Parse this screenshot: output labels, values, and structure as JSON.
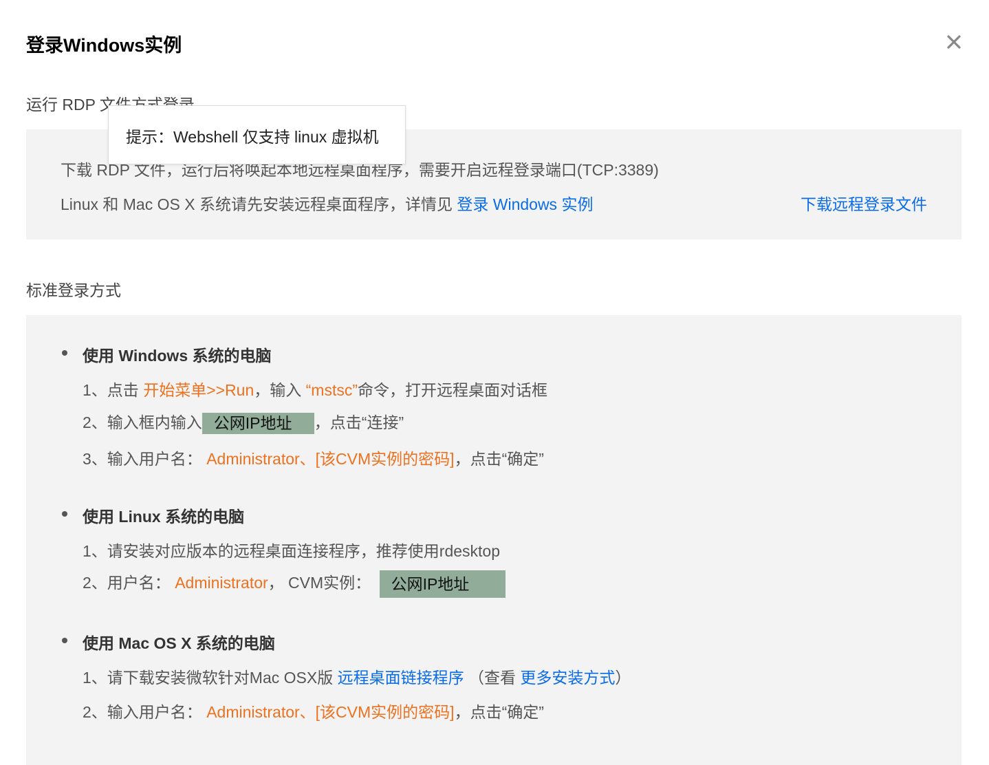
{
  "dialog": {
    "title": "登录Windows实例",
    "close_icon": "close-icon"
  },
  "rdp": {
    "section_title": "运行 RDP 文件方式登录",
    "line1": "下载 RDP 文件，运行后将唤起本地远程桌面程序，需要开启远程登录端口(TCP:3389)",
    "line2_prefix": "Linux 和 Mac OS X 系统请先安装远程桌面程序，详情见 ",
    "line2_link": "登录 Windows 实例",
    "download_link": "下载远程登录文件"
  },
  "tooltip": {
    "text": "提示：Webshell 仅支持 linux 虚拟机"
  },
  "standard": {
    "section_title": "标准登录方式",
    "windows": {
      "heading": "使用 Windows 系统的电脑",
      "step1_prefix": "1、点击 ",
      "step1_menu": "开始菜单>>Run",
      "step1_mid": "，输入 ",
      "step1_cmd": "“mstsc”",
      "step1_suffix": "命令，打开远程桌面对话框",
      "step2_prefix": "2、输入框内输入",
      "step2_ip": "公网IP地址",
      "step2_suffix": "，点击“连接”",
      "step3_prefix": "3、输入用户名：  ",
      "step3_creds": "Administrator、[该CVM实例的密码]",
      "step3_suffix": "，点击“确定”"
    },
    "linux": {
      "heading": "使用 Linux 系统的电脑",
      "step1": "1、请安装对应版本的远程桌面连接程序，推荐使用rdesktop",
      "step2_prefix": "2、用户名：  ",
      "step2_user": "Administrator",
      "step2_mid": "，  CVM实例：  ",
      "step2_ip": "公网IP地址"
    },
    "mac": {
      "heading": "使用 Mac OS X 系统的电脑",
      "step1_prefix": "1、请下载安装微软针对Mac OSX版 ",
      "step1_link": "远程桌面链接程序",
      "step1_mid": " （查看 ",
      "step1_link2": "更多安装方式",
      "step1_suffix": "）",
      "step2_prefix": "2、输入用户名：  ",
      "step2_creds": "Administrator、[该CVM实例的密码]",
      "step2_suffix": "，点击“确定”"
    }
  },
  "colors": {
    "link": "#0a6ce9",
    "accent_orange": "#ed711f",
    "ip_highlight": "#91ad99",
    "panel_bg": "#f3f3f3"
  }
}
